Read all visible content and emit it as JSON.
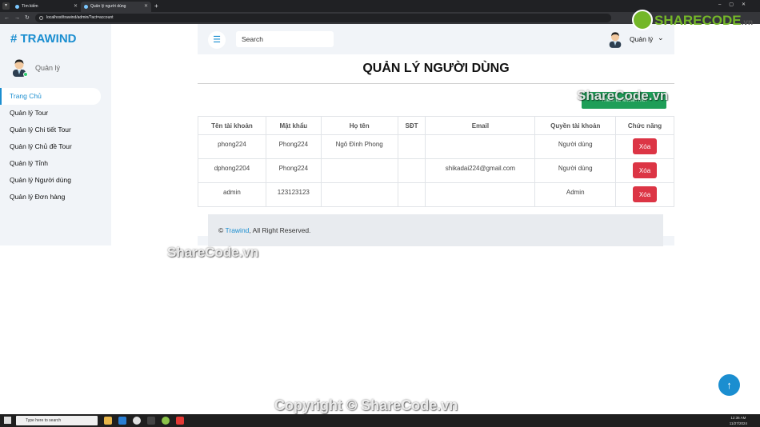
{
  "browser": {
    "tabs": [
      {
        "label": "Tìm kiếm"
      },
      {
        "label": "Quản lý người dùng"
      }
    ],
    "url": "localhost/trawind/admin/?act=account"
  },
  "sidebar": {
    "brand": "# TRAWIND",
    "user_label": "Quản lý",
    "items": [
      {
        "label": "Trang Chủ"
      },
      {
        "label": "Quản lý Tour"
      },
      {
        "label": "Quản lý Chi tiết Tour"
      },
      {
        "label": "Quản lý Chủ đề Tour"
      },
      {
        "label": "Quản lý Tỉnh"
      },
      {
        "label": "Quản lý Người dùng"
      },
      {
        "label": "Quản lý Đơn hàng"
      }
    ]
  },
  "topbar": {
    "search_placeholder": "Search",
    "user_label": "Quản lý"
  },
  "main": {
    "title": "QUẢN LÝ NGƯỜI DÙNG",
    "add_button": "Thêm tài khoản mới",
    "table": {
      "headers": [
        "Tên tài khoản",
        "Mật khẩu",
        "Họ tên",
        "SĐT",
        "Email",
        "Quyền tài khoản",
        "Chức năng"
      ],
      "rows": [
        {
          "username": "phong224",
          "password": "Phong224",
          "fullname": "Ngô Đình Phong",
          "phone": "",
          "email": "",
          "role": "Người dùng",
          "action": "Xóa"
        },
        {
          "username": "dphong2204",
          "password": "Phong224",
          "fullname": "",
          "phone": "",
          "email": "shikadai224@gmail.com",
          "role": "Người dùng",
          "action": "Xóa"
        },
        {
          "username": "admin",
          "password": "123123123",
          "fullname": "",
          "phone": "",
          "email": "",
          "role": "Admin",
          "action": "Xóa"
        }
      ]
    }
  },
  "footer": {
    "prefix": "© ",
    "brand": "Trawind",
    "suffix": ", All Right Reserved."
  },
  "watermarks": {
    "logo": "SHARECODE",
    "logo_suffix": ".vn",
    "mark": "ShareCode.vn",
    "copyright": "Copyright © ShareCode.vn"
  },
  "taskbar": {
    "search_placeholder": "Type here to search",
    "time": "12:36 AM",
    "date": "11/27/2024"
  },
  "colors": {
    "accent": "#1b8ed0",
    "success": "#1e9e58",
    "danger": "#dc3545",
    "panel_bg": "#f1f4f8"
  }
}
